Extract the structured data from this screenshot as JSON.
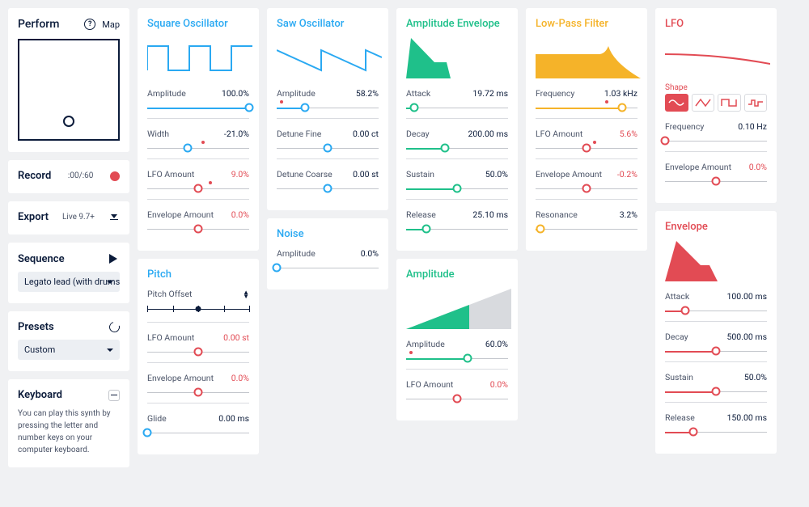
{
  "perform": {
    "title": "Perform",
    "map_label": "Map",
    "help": "?"
  },
  "record": {
    "title": "Record",
    "time": ":00/:60"
  },
  "export": {
    "title": "Export",
    "target": "Live 9.7+"
  },
  "sequence": {
    "title": "Sequence",
    "preset": "Legato lead (with drums)"
  },
  "presets": {
    "title": "Presets",
    "selected": "Custom"
  },
  "keyboard": {
    "title": "Keyboard",
    "desc": "You can play this synth by pressing the letter and number keys on your computer keyboard."
  },
  "square": {
    "title": "Square Oscillator",
    "amplitude": {
      "label": "Amplitude",
      "value": "100.0%",
      "pos": 100
    },
    "width": {
      "label": "Width",
      "value": "-21.0%",
      "pos": 40,
      "mark": 55
    },
    "lfo": {
      "label": "LFO Amount",
      "value": "9.0%",
      "pos": 50,
      "mark": 62,
      "red": true
    },
    "env": {
      "label": "Envelope Amount",
      "value": "0.0%",
      "pos": 50,
      "red": true
    }
  },
  "pitch": {
    "title": "Pitch",
    "offset_label": "Pitch Offset",
    "lfo": {
      "label": "LFO Amount",
      "value": "0.00 st",
      "pos": 50,
      "red": true
    },
    "env": {
      "label": "Envelope Amount",
      "value": "0.0%",
      "pos": 50,
      "red": true
    },
    "glide": {
      "label": "Glide",
      "value": "0.00 ms",
      "pos": 0
    }
  },
  "saw": {
    "title": "Saw Oscillator",
    "amplitude": {
      "label": "Amplitude",
      "value": "58.2%",
      "pos": 28,
      "mark": 5
    },
    "fine": {
      "label": "Detune Fine",
      "value": "0.00 ct",
      "pos": 50
    },
    "coarse": {
      "label": "Detune Coarse",
      "value": "0.00 st",
      "pos": 50
    }
  },
  "noise": {
    "title": "Noise",
    "amplitude": {
      "label": "Amplitude",
      "value": "0.0%",
      "pos": 0
    }
  },
  "ampenv": {
    "title": "Amplitude Envelope",
    "attack": {
      "label": "Attack",
      "value": "19.72 ms",
      "pos": 8
    },
    "decay": {
      "label": "Decay",
      "value": "200.00 ms",
      "pos": 38
    },
    "sustain": {
      "label": "Sustain",
      "value": "50.0%",
      "pos": 50
    },
    "release": {
      "label": "Release",
      "value": "25.10 ms",
      "pos": 20
    }
  },
  "amplitude": {
    "title": "Amplitude",
    "amp": {
      "label": "Amplitude",
      "value": "60.0%",
      "pos": 60,
      "mark": 5
    },
    "lfo": {
      "label": "LFO Amount",
      "value": "0.0%",
      "pos": 50,
      "red": true
    }
  },
  "filter": {
    "title": "Low-Pass Filter",
    "freq": {
      "label": "Frequency",
      "value": "1.03 kHz",
      "pos": 85,
      "mark": 70
    },
    "lfo": {
      "label": "LFO Amount",
      "value": "5.6%",
      "pos": 50,
      "mark": 58,
      "red": true
    },
    "env": {
      "label": "Envelope Amount",
      "value": "-0.2%",
      "pos": 50,
      "red": true
    },
    "res": {
      "label": "Resonance",
      "value": "3.2%",
      "pos": 5
    }
  },
  "lfo": {
    "title": "LFO",
    "shape_label": "Shape",
    "freq": {
      "label": "Frequency",
      "value": "0.10 Hz",
      "pos": 0
    },
    "env": {
      "label": "Envelope Amount",
      "value": "0.0%",
      "pos": 50,
      "red": true
    }
  },
  "env2": {
    "title": "Envelope",
    "attack": {
      "label": "Attack",
      "value": "100.00 ms",
      "pos": 20
    },
    "decay": {
      "label": "Decay",
      "value": "500.00 ms",
      "pos": 50
    },
    "sustain": {
      "label": "Sustain",
      "value": "50.0%",
      "pos": 50
    },
    "release": {
      "label": "Release",
      "value": "150.00 ms",
      "pos": 28
    }
  }
}
